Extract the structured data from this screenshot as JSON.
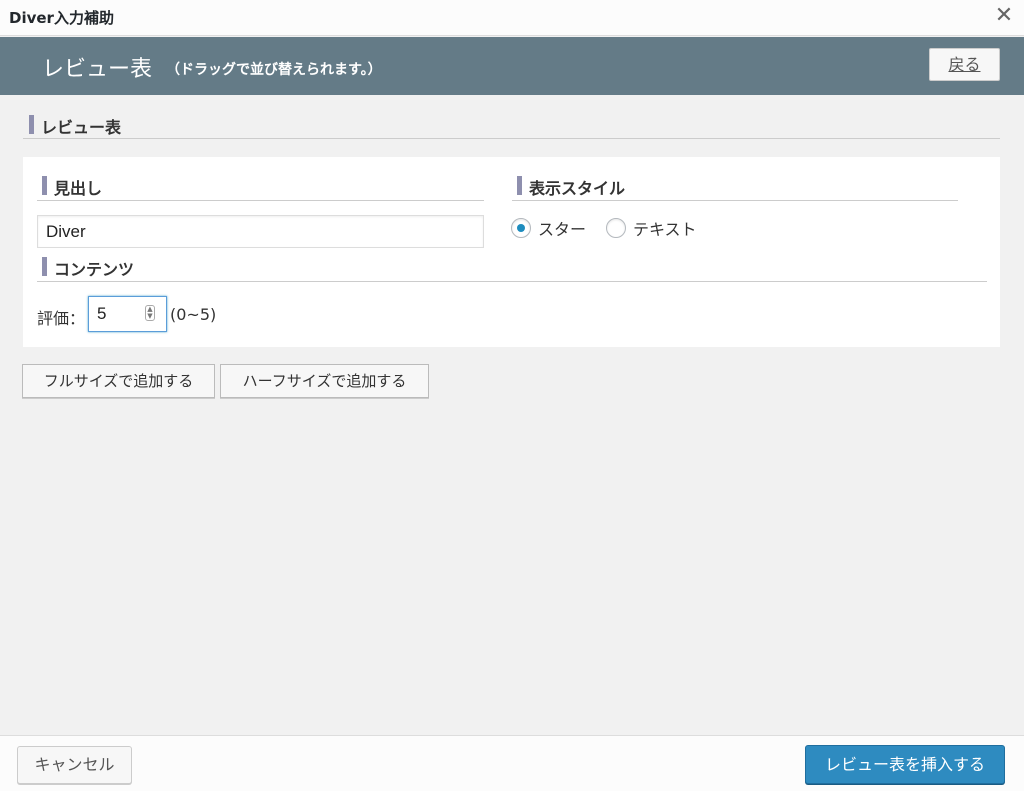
{
  "window": {
    "title": "Diver入力補助",
    "close_icon": "close-icon"
  },
  "header": {
    "title": "レビュー表",
    "note": "（ドラッグで並び替えられます。）",
    "back_label": "戻る"
  },
  "section": {
    "heading": "レビュー表"
  },
  "panel": {
    "heading_label": "見出し",
    "heading_value": "Diver",
    "style_label": "表示スタイル",
    "style_options": [
      {
        "label": "スター",
        "checked": true
      },
      {
        "label": "テキスト",
        "checked": false
      }
    ],
    "content_label": "コンテンツ",
    "rating_label": "評価：",
    "rating_value": "5",
    "rating_range": "(0~5)"
  },
  "actions": {
    "add_full": "フルサイズで追加する",
    "add_half": "ハーフサイズで追加する"
  },
  "footer": {
    "cancel_label": "キャンセル",
    "insert_label": "レビュー表を挿入する"
  },
  "colors": {
    "header_bg": "#647b87",
    "accent_bar": "#8e8fae",
    "primary_button": "#2e8bc0",
    "radio_selected": "#1e8cbe"
  }
}
